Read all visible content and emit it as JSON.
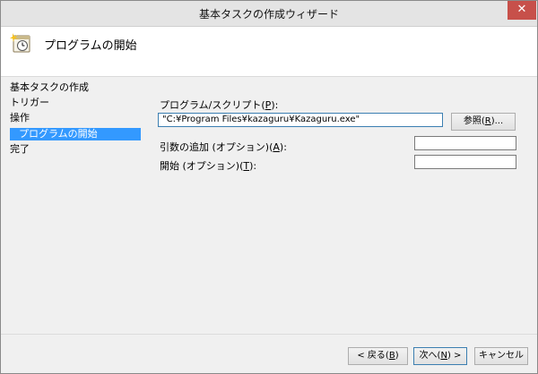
{
  "window": {
    "title": "基本タスクの作成ウィザード",
    "close_glyph": "✕"
  },
  "header": {
    "title": "プログラムの開始",
    "icon": "task-clock-icon"
  },
  "sidebar": {
    "items": [
      {
        "label": "基本タスクの作成",
        "selected": false
      },
      {
        "label": "トリガー",
        "selected": false
      },
      {
        "label": "操作",
        "selected": false
      },
      {
        "label": "プログラムの開始",
        "selected": true
      },
      {
        "label": "完了",
        "selected": false
      }
    ]
  },
  "form": {
    "program": {
      "label_prefix": "プログラム/スクリプト(",
      "label_key": "P",
      "label_suffix": "):",
      "value": "\"C:¥Program Files¥kazaguru¥Kazaguru.exe\""
    },
    "browse_button": {
      "prefix": "参照(",
      "key": "R",
      "suffix": ")..."
    },
    "args": {
      "label_prefix": "引数の追加 (オプション)(",
      "label_key": "A",
      "label_suffix": "):",
      "value": ""
    },
    "start": {
      "label_prefix": "開始 (オプション)(",
      "label_key": "T",
      "label_suffix": "):",
      "value": ""
    }
  },
  "footer": {
    "back": {
      "prefix": "< 戻る(",
      "key": "B",
      "suffix": ")"
    },
    "next": {
      "prefix": "次へ(",
      "key": "N",
      "suffix": ") >"
    },
    "cancel": "キャンセル"
  },
  "colors": {
    "selection": "#3399ff",
    "close_button": "#c7504a"
  }
}
